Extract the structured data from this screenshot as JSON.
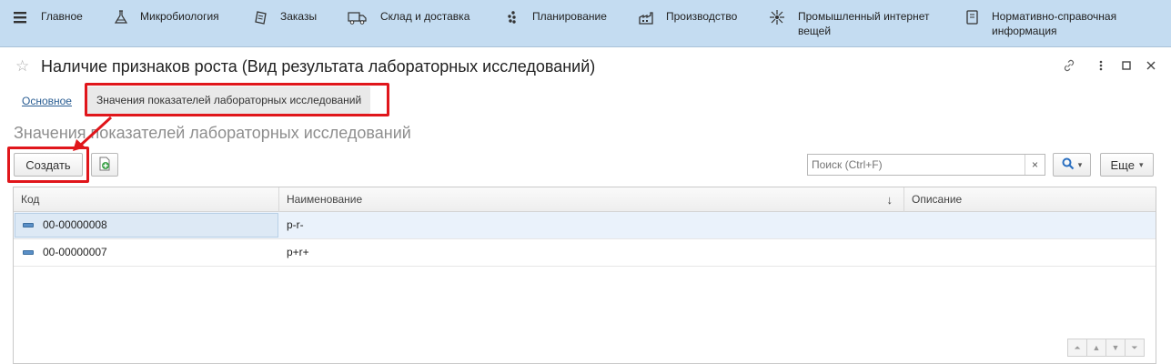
{
  "topnav": {
    "items": [
      {
        "label": "Главное",
        "icon": "hamburger-menu-icon"
      },
      {
        "label": "Микробиология",
        "icon": "flask-icon"
      },
      {
        "label": "Заказы",
        "icon": "document-stack-icon"
      },
      {
        "label": "Склад и доставка",
        "icon": "delivery-truck-icon"
      },
      {
        "label": "Планирование",
        "icon": "dots-cluster-icon"
      },
      {
        "label": "Производство",
        "icon": "factory-icon"
      },
      {
        "label": "Промышленный интернет вещей",
        "icon": "network-hub-icon"
      },
      {
        "label": "Нормативно-справочная информация",
        "icon": "reference-book-icon"
      }
    ],
    "background": "#c4dcf1"
  },
  "form": {
    "title": "Наличие признаков роста (Вид результата лабораторных исследований)",
    "controls": {
      "link": "🔗",
      "more": "⋮",
      "maximize": "□",
      "close": "✕"
    }
  },
  "tabs": {
    "main": "Основное",
    "values": "Значения показателей лабораторных исследований"
  },
  "section": {
    "title": "Значения показателей лабораторных исследований"
  },
  "toolbar": {
    "create_label": "Создать",
    "search_placeholder": "Поиск (Ctrl+F)",
    "clear": "×",
    "more_label": "Еще",
    "dropdown_arrow": "▾"
  },
  "table": {
    "columns": [
      "Код",
      "Наименование",
      "Описание"
    ],
    "sort_indicator": "↓",
    "rows": [
      {
        "code": "00-00000008",
        "name": "p-r-",
        "description": ""
      },
      {
        "code": "00-00000007",
        "name": "p+r+",
        "description": ""
      }
    ]
  },
  "scroll": {
    "first": "⏶",
    "up": "▲",
    "down": "▼",
    "last": "⏷"
  },
  "colors": {
    "nav_bg": "#c4dcf1",
    "link": "#2b5e93",
    "selection": "#dde9f5",
    "annotation": "#e0161b"
  }
}
